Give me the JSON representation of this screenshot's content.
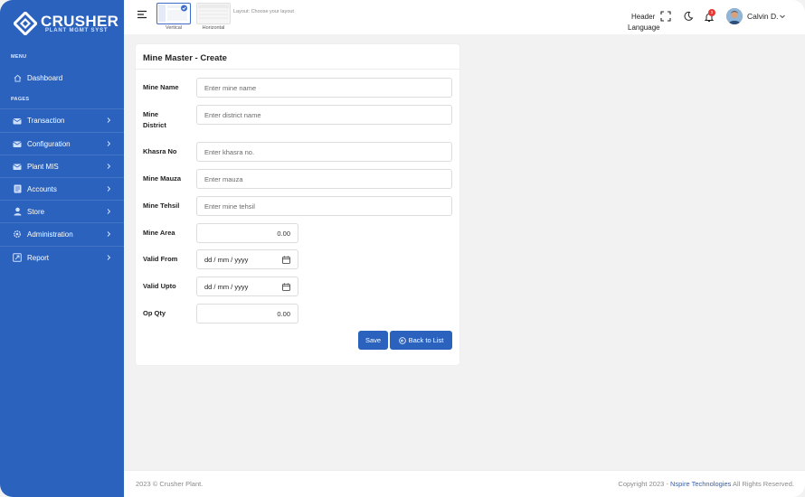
{
  "brand": {
    "title": "CRUSHER",
    "subtitle": "PLANT MGMT SYST"
  },
  "sidebar": {
    "menu_label": "MENU",
    "pages_label": "PAGES",
    "dashboard": {
      "label": "Dashboard",
      "icon": "home-icon"
    },
    "items": [
      {
        "label": "Transaction",
        "icon": "transaction-icon"
      },
      {
        "label": "Configuration",
        "icon": "mail-icon"
      },
      {
        "label": "Plant MIS",
        "icon": "mail-icon"
      },
      {
        "label": "Accounts",
        "icon": "document-icon"
      },
      {
        "label": "Store",
        "icon": "user-icon"
      },
      {
        "label": "Administration",
        "icon": "gear-icon"
      },
      {
        "label": "Report",
        "icon": "report-icon"
      }
    ]
  },
  "header": {
    "layout_options": [
      {
        "label": "Vertical",
        "selected": true
      },
      {
        "label": "Horizontal",
        "selected": false
      }
    ],
    "layout_hint": "Layout: Choose your layout",
    "header_label": "Header",
    "language_label": "Language",
    "notification_count": "3",
    "user_name": "Calvin D."
  },
  "form": {
    "title": "Mine Master - Create",
    "fields": {
      "mine_name": {
        "label": "Mine Name",
        "placeholder": "Enter mine name"
      },
      "mine_district": {
        "label_line1": "Mine",
        "label_line2": "District",
        "placeholder": "Enter district name"
      },
      "khasra_no": {
        "label": "Khasra No",
        "placeholder": "Enter khasra no."
      },
      "mine_mauza": {
        "label": "Mine Mauza",
        "placeholder": "Enter mauza"
      },
      "mine_tehsil": {
        "label": "Mine Tehsil",
        "placeholder": "Enter mine tehsil"
      },
      "mine_area": {
        "label": "Mine Area",
        "value": "0.00"
      },
      "valid_from": {
        "label": "Valid From",
        "value": "dd / mm / yyyy"
      },
      "valid_upto": {
        "label": "Valid Upto",
        "value": "dd / mm / yyyy"
      },
      "op_qty": {
        "label": "Op Qty",
        "value": "0.00"
      }
    },
    "save_label": "Save",
    "back_label": "Back to List"
  },
  "footer": {
    "left": "2023 © Crusher Plant.",
    "right_prefix": "Copyright 2023 - ",
    "right_link": "Nspire Technologies",
    "right_suffix": " All Rights Reserved."
  },
  "colors": {
    "sidebar": "#2a62be",
    "accent": "#2a62be",
    "badge": "#e53935"
  }
}
